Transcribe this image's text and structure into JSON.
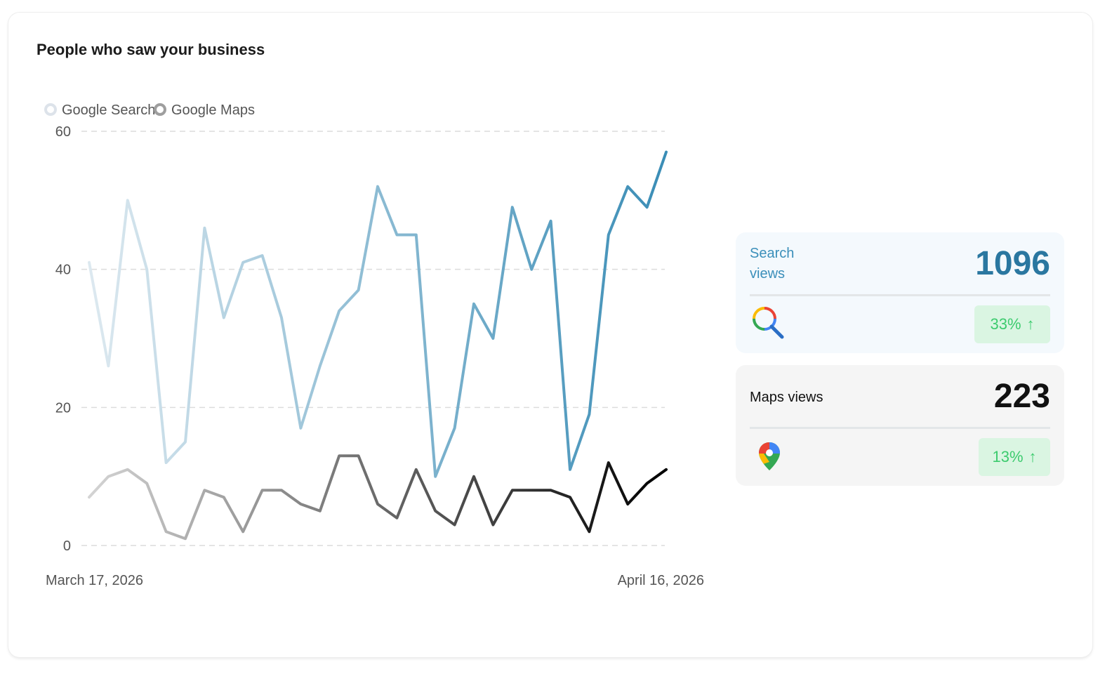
{
  "card": {
    "title": "People who saw your business"
  },
  "legend": [
    {
      "label": "Google Search",
      "color": "#dde3ea"
    },
    {
      "label": "Google Maps",
      "color": "#9e9e9e"
    }
  ],
  "chart_data": {
    "type": "line",
    "x_start": "March 17, 2026",
    "x_end": "April 16, 2026",
    "ylim": [
      0,
      60
    ],
    "yticks": [
      0,
      20,
      40,
      60
    ],
    "grid": true,
    "legend_position": "top-left",
    "series": [
      {
        "name": "Google Search",
        "color_start": "#dde9f0",
        "color_end": "#3a8db6",
        "values": [
          41,
          26,
          50,
          40,
          12,
          15,
          46,
          33,
          41,
          42,
          33,
          17,
          26,
          34,
          37,
          52,
          45,
          45,
          10,
          17,
          35,
          30,
          49,
          40,
          47,
          11,
          19,
          45,
          52,
          49,
          57
        ]
      },
      {
        "name": "Google Maps",
        "color_start": "#d4d4d4",
        "color_end": "#000000",
        "values": [
          7,
          10,
          11,
          9,
          2,
          1,
          8,
          7,
          2,
          8,
          8,
          6,
          5,
          13,
          13,
          6,
          4,
          11,
          5,
          3,
          10,
          3,
          8,
          8,
          8,
          7,
          2,
          12,
          6,
          9,
          11
        ]
      }
    ]
  },
  "stats": {
    "search": {
      "label": "Search views",
      "value": "1096",
      "change": "33%",
      "arrow": "↑"
    },
    "maps": {
      "label": "Maps views",
      "value": "223",
      "change": "13%",
      "arrow": "↑"
    }
  },
  "icons": {
    "search": "google-search-icon",
    "maps": "google-maps-pin-icon",
    "arrow": "arrow-up-icon"
  }
}
